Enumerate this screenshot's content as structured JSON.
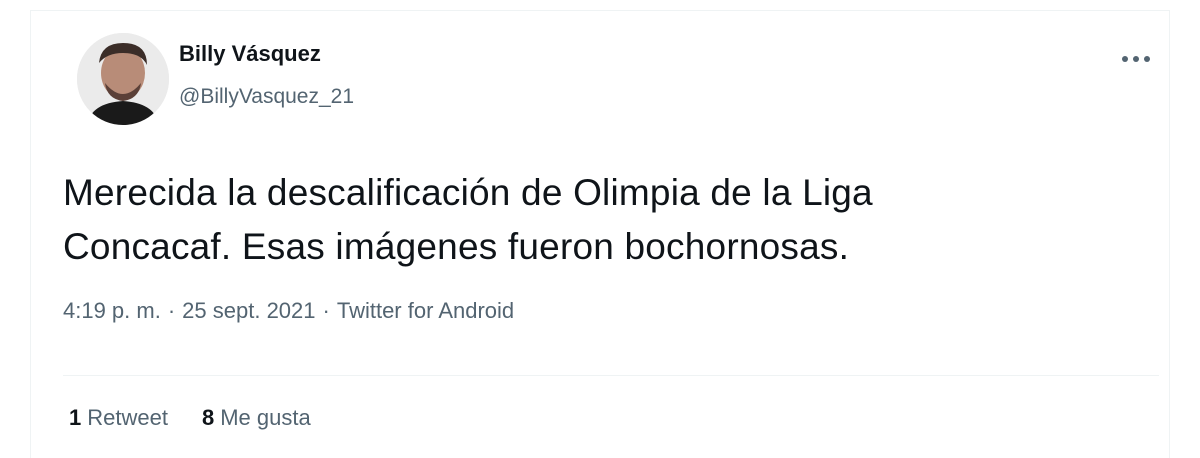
{
  "user": {
    "display_name": "Billy Vásquez",
    "handle": "@BillyVasquez_21"
  },
  "tweet": {
    "text_line_1": "Merecida la descalificación de Olimpia de la Liga",
    "text_line_2": "Concacaf. Esas imágenes fueron bochornosas."
  },
  "meta": {
    "time": "4:19 p. m.",
    "separator": "·",
    "date": "25 sept. 2021",
    "source": "Twitter for Android"
  },
  "stats": {
    "retweets_count": "1",
    "retweets_label": "Retweet",
    "likes_count": "8",
    "likes_label": "Me gusta"
  },
  "icons": {
    "more": "more-dots-icon",
    "avatar": "profile-photo"
  }
}
